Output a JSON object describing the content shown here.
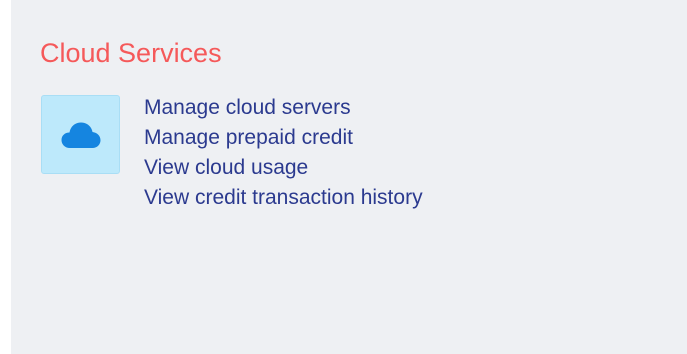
{
  "panel": {
    "title": "Cloud Services",
    "title_color": "#f5595a",
    "background": "#eef0f3",
    "icon": {
      "name": "cloud-icon",
      "color": "#1585e0",
      "tile_color": "#bde9fb"
    },
    "links": [
      {
        "label": "Manage cloud servers"
      },
      {
        "label": "Manage prepaid credit"
      },
      {
        "label": "View cloud usage"
      },
      {
        "label": "View credit transaction history"
      }
    ],
    "link_color": "#2b3a8f"
  }
}
